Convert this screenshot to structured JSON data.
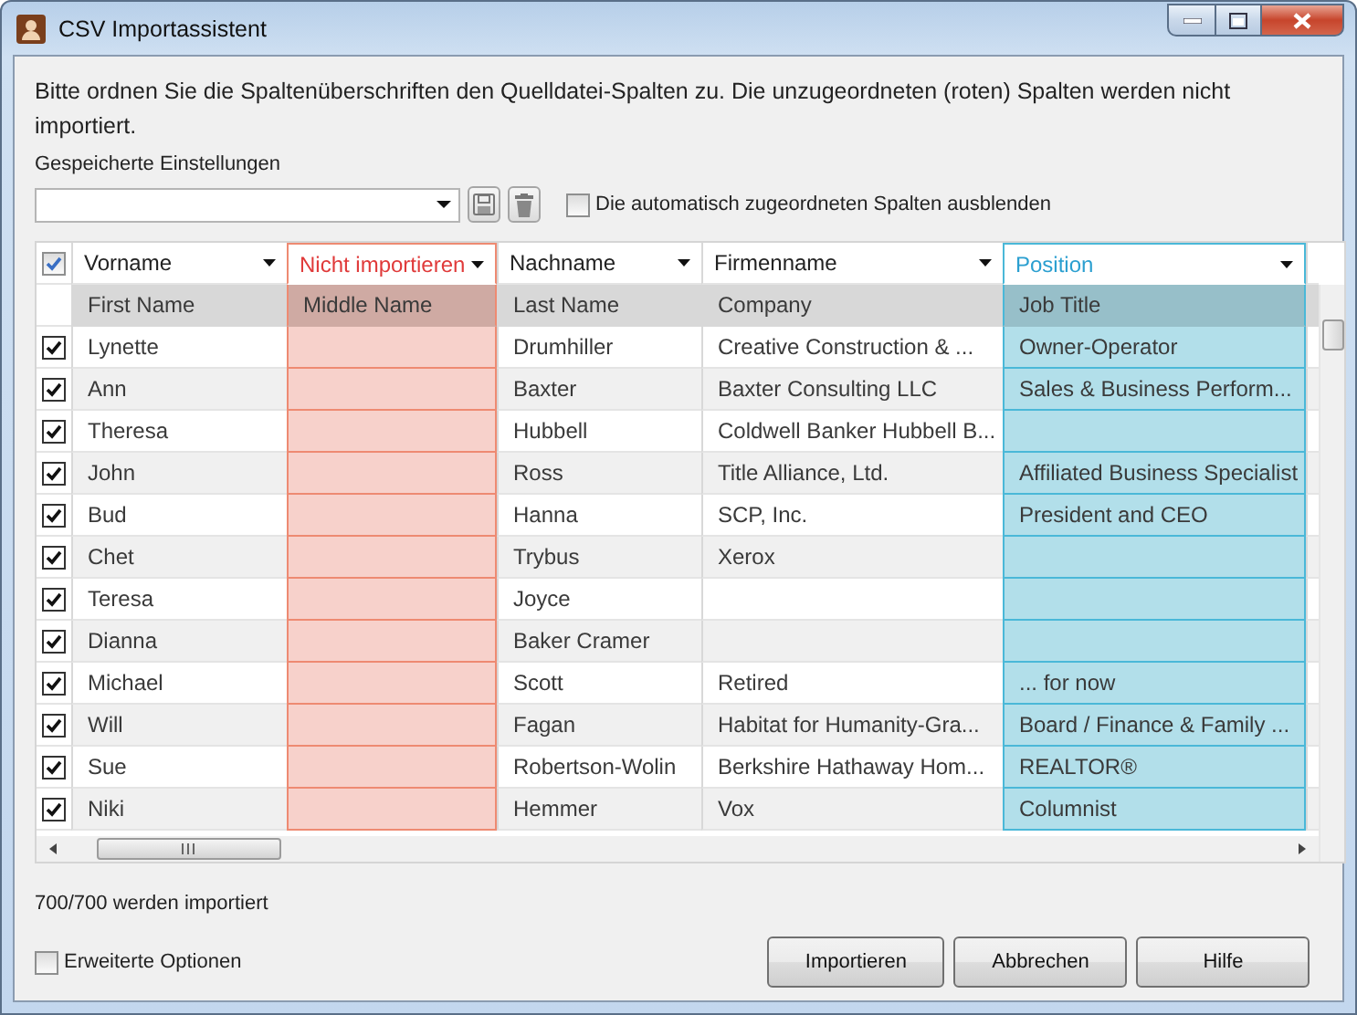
{
  "window": {
    "title": "CSV Importassistent"
  },
  "instructions": "Bitte ordnen Sie die Spaltenüberschriften den Quelldatei-Spalten zu. Die unzugeordneten (roten) Spalten werden nicht importiert.",
  "saved_settings": {
    "label": "Gespeicherte Einstellungen"
  },
  "hide_auto_mapped": {
    "label": "Die automatisch zugeordneten Spalten ausblenden",
    "checked": false
  },
  "table": {
    "select_all": {
      "checked": true
    },
    "columns": [
      {
        "label": "Vorname",
        "source": "First Name",
        "ignored": false,
        "selected": false
      },
      {
        "label": "Nicht importieren",
        "source": "Middle Name",
        "ignored": true,
        "selected": false
      },
      {
        "label": "Nachname",
        "source": "Last Name",
        "ignored": false,
        "selected": false
      },
      {
        "label": "Firmenname",
        "source": "Company",
        "ignored": false,
        "selected": false
      },
      {
        "label": "Position",
        "source": "Job Title",
        "ignored": false,
        "selected": true
      }
    ],
    "rows": [
      {
        "checked": true,
        "cells": [
          "Lynette",
          "",
          "Drumhiller",
          "Creative Construction & ...",
          "Owner-Operator"
        ]
      },
      {
        "checked": true,
        "cells": [
          "Ann",
          "",
          "Baxter",
          "Baxter Consulting LLC",
          "Sales & Business Perform..."
        ]
      },
      {
        "checked": true,
        "cells": [
          "Theresa",
          "",
          "Hubbell",
          "Coldwell Banker Hubbell B...",
          ""
        ]
      },
      {
        "checked": true,
        "cells": [
          "John",
          "",
          "Ross",
          "Title Alliance, Ltd.",
          "Affiliated Business Specialist"
        ]
      },
      {
        "checked": true,
        "cells": [
          "Bud",
          "",
          "Hanna",
          "SCP, Inc.",
          "President and CEO"
        ]
      },
      {
        "checked": true,
        "cells": [
          "Chet",
          "",
          "Trybus",
          "Xerox",
          ""
        ]
      },
      {
        "checked": true,
        "cells": [
          "Teresa",
          "",
          "Joyce",
          "",
          ""
        ]
      },
      {
        "checked": true,
        "cells": [
          "Dianna",
          "",
          "Baker Cramer",
          "",
          ""
        ]
      },
      {
        "checked": true,
        "cells": [
          "Michael",
          "",
          "Scott",
          "Retired",
          "... for now"
        ]
      },
      {
        "checked": true,
        "cells": [
          "Will",
          "",
          "Fagan",
          "Habitat for Humanity-Gra...",
          "Board / Finance & Family ..."
        ]
      },
      {
        "checked": true,
        "cells": [
          "Sue",
          "",
          "Robertson-Wolin",
          "Berkshire Hathaway Hom...",
          "REALTOR®"
        ]
      },
      {
        "checked": true,
        "cells": [
          "Niki",
          "",
          "Hemmer",
          "Vox",
          "Columnist"
        ]
      }
    ]
  },
  "import_count": "700/700 werden importiert",
  "advanced_options": {
    "label": "Erweiterte Optionen",
    "checked": false
  },
  "buttons": [
    "Importieren",
    "Abbrechen",
    "Hilfe"
  ]
}
